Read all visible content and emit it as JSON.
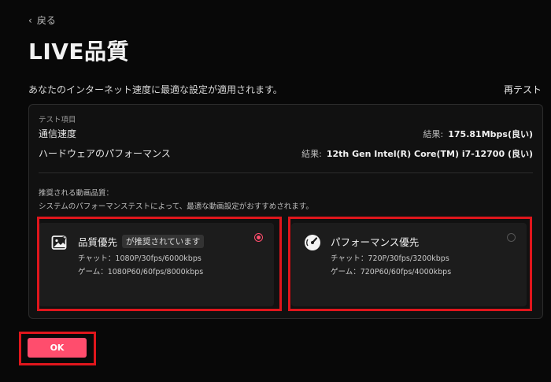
{
  "nav": {
    "back_label": "戻る"
  },
  "page": {
    "title": "LIVE品質",
    "description": "あなたのインターネット速度に最適な設定が適用されます。",
    "retest_label": "再テスト"
  },
  "test": {
    "header": "テスト項目",
    "rows": [
      {
        "label": "通信速度",
        "result_label": "結果:",
        "result_value": "175.81Mbps(良い)"
      },
      {
        "label": "ハードウェアのパフォーマンス",
        "result_label": "結果:",
        "result_value": "12th Gen Intel(R) Core(TM) i7-12700 (良い)"
      }
    ]
  },
  "recommend": {
    "header": "推奨される動画品質：",
    "subtext": "システムのパフォーマンステストによって、最適な動画設定がおすすめされます。"
  },
  "options": [
    {
      "name": "品質優先",
      "badge": "が推奨されています",
      "chat": "チャット：1080P/30fps/6000kbps",
      "game": "ゲーム：1080P60/60fps/8000kbps",
      "icon": "image-sparkle-icon",
      "selected": true
    },
    {
      "name": "パフォーマンス優先",
      "badge": "",
      "chat": "チャット：720P/30fps/3200kbps",
      "game": "ゲーム：720P60/60fps/4000kbps",
      "icon": "speedometer-icon",
      "selected": false
    }
  ],
  "actions": {
    "ok_label": "OK"
  },
  "colors": {
    "accent": "#ff4d6d",
    "highlight": "#e0161c",
    "background": "#080808",
    "panel": "#111111",
    "card": "#1c1c1c"
  }
}
